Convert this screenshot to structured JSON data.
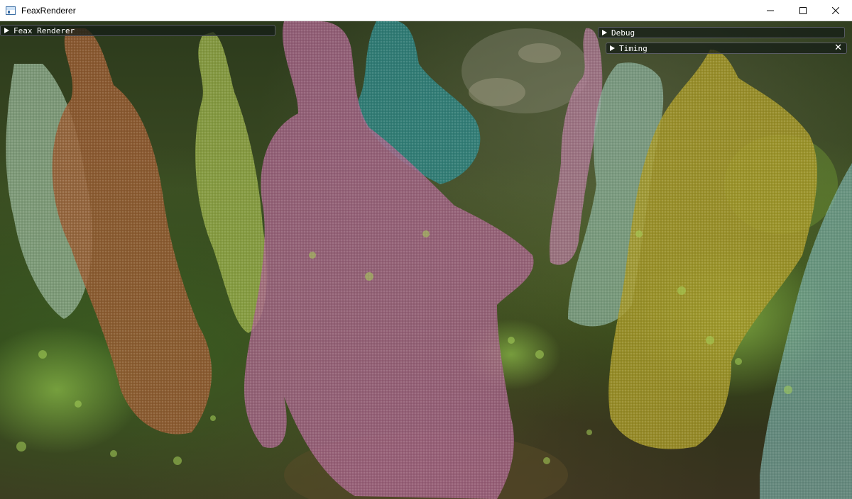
{
  "window": {
    "title": "FeaxRenderer",
    "minimize_icon": "minimize-icon",
    "maximize_icon": "maximize-icon",
    "close_icon": "close-icon"
  },
  "panels": {
    "main": {
      "label": "Feax Renderer",
      "icon": "collapse-triangle-icon"
    },
    "debug": {
      "label": "Debug",
      "icon": "collapse-triangle-icon"
    },
    "timing": {
      "label": "Timing",
      "icon": "collapse-triangle-icon",
      "close_symbol": "✕"
    }
  },
  "colors": {
    "forest_dark": "#2a3316",
    "forest_light": "#5a7a2a",
    "figure_pink": "#b06a8a",
    "figure_teal": "#3a8a8a",
    "figure_olive": "#a8a03a",
    "figure_rust": "#a0623a",
    "figure_sage": "#8ab07a",
    "panel_bg": "#141c16",
    "panel_border": "#6e6e7d"
  }
}
